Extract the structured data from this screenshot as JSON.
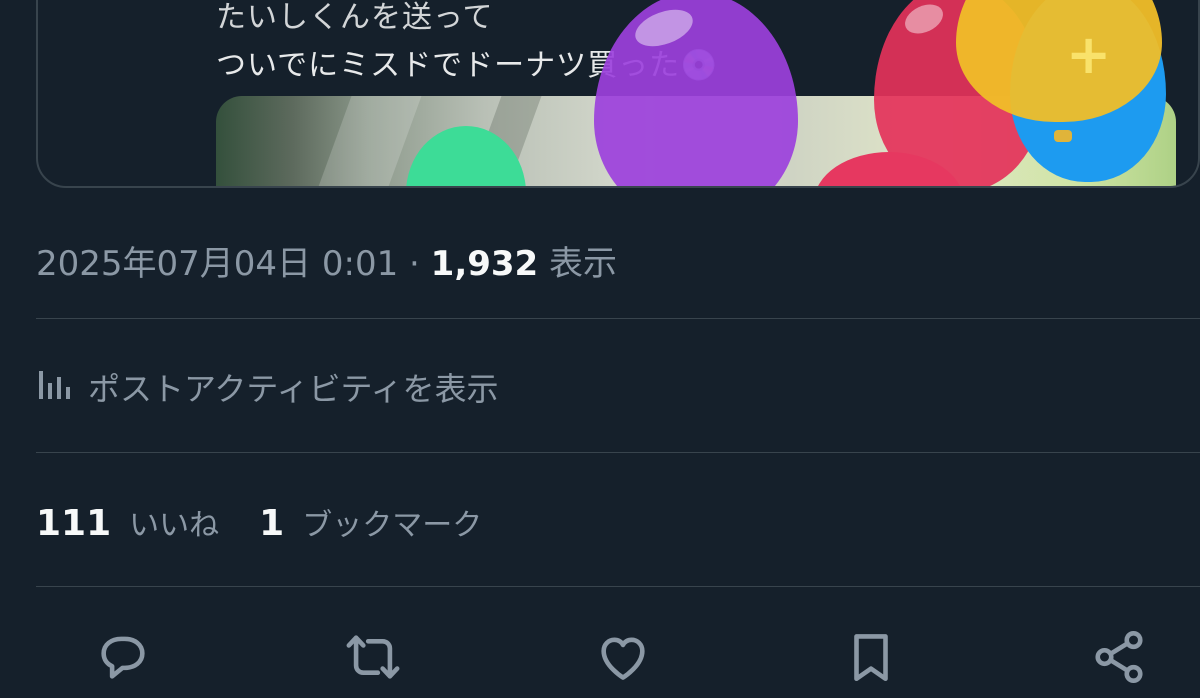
{
  "quoted_post": {
    "line1": "たいしくんを送って",
    "line2": "ついでにミスドでドーナツ買った💿"
  },
  "post_meta": {
    "date": "2025年07月04日 0:01",
    "separator": "·",
    "views": "1,932",
    "views_label": "表示"
  },
  "activity": {
    "label": "ポストアクティビティを表示",
    "icon": "bar-chart-icon"
  },
  "stats": {
    "likes_count": "111",
    "likes_label": "いいね",
    "bookmarks_count": "1",
    "bookmarks_label": "ブックマーク"
  },
  "actions": [
    {
      "name": "reply",
      "icon": "speech-bubble-icon"
    },
    {
      "name": "repost",
      "icon": "repost-arrows-icon"
    },
    {
      "name": "like",
      "icon": "heart-icon"
    },
    {
      "name": "bookmark",
      "icon": "bookmark-icon"
    },
    {
      "name": "share",
      "icon": "share-nodes-icon"
    }
  ],
  "colors": {
    "background": "#15202b",
    "secondary_text": "#8b98a5",
    "primary_text": "#f7f9f9",
    "divider": "#38444d"
  }
}
